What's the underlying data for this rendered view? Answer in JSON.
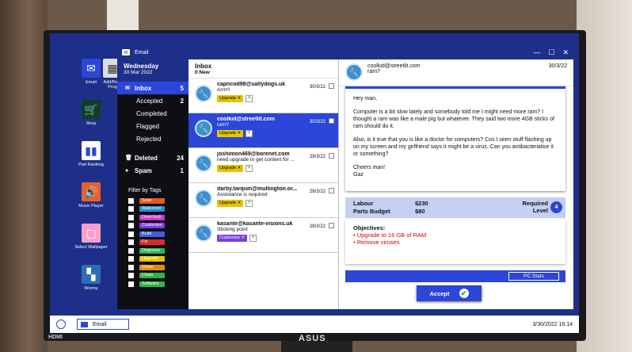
{
  "desktop": {
    "icons": [
      {
        "label": "Email",
        "name": "email",
        "color": "#2b46d8",
        "glyph": "✉"
      },
      {
        "label": "Add/Rem Prog",
        "name": "add-remove",
        "color": "#ddd",
        "glyph": "▦"
      },
      {
        "label": "Shop",
        "name": "shop",
        "color": "#1e7d3a",
        "glyph": "🛒"
      },
      {
        "label": "Part Ranking",
        "name": "part-ranking",
        "color": "#ffffff",
        "glyph": "▮"
      },
      {
        "label": "Music Player",
        "name": "music-player",
        "color": "#e8612c",
        "glyph": "🔊"
      },
      {
        "label": "Select Wallpaper",
        "name": "select-wallpaper",
        "color": "#ff9ec8",
        "glyph": "▢"
      },
      {
        "label": "Wormy",
        "name": "wormy",
        "color": "#2a6fb8",
        "glyph": "▚"
      }
    ]
  },
  "window": {
    "title": "Email"
  },
  "sidebar": {
    "day": "Wednesday",
    "date": "30 Mar 2022",
    "inbox": {
      "label": "Inbox",
      "count": "5"
    },
    "accepted": {
      "label": "Accepted",
      "count": "2"
    },
    "completed": {
      "label": "Completed"
    },
    "flagged": {
      "label": "Flagged"
    },
    "rejected": {
      "label": "Rejected"
    },
    "deleted": {
      "label": "Deleted",
      "count": "24"
    },
    "spam": {
      "label": "Spam",
      "count": "1"
    },
    "filter_title": "Filter by Tags",
    "tags": [
      {
        "label": "Scan",
        "color": "#e25a1c"
      },
      {
        "label": "Watercool",
        "color": "#2a8ad4"
      },
      {
        "label": "Overclock",
        "color": "#c43bd1"
      },
      {
        "label": "Customise",
        "color": "#7b3fe0"
      },
      {
        "label": "Build",
        "color": "#3c5ee0"
      },
      {
        "label": "Fix",
        "color": "#e02828"
      },
      {
        "label": "Diagnose",
        "color": "#2fb34a"
      },
      {
        "label": "Upgrade",
        "color": "#e5c400"
      },
      {
        "label": "Clone",
        "color": "#e08a1c"
      },
      {
        "label": "Clean",
        "color": "#2fb34a"
      },
      {
        "label": "Software",
        "color": "#2fb34a"
      }
    ]
  },
  "list": {
    "title": "Inbox",
    "subtitle": "0 New",
    "mails": [
      {
        "from": "capncod98@saltydogs.uk",
        "subject": "Arrrr!!",
        "date": "30/3/22",
        "tag": "Upgrade",
        "tag_color": "#e5c400"
      },
      {
        "from": "coolkid@streetlit.com",
        "subject": "ram?",
        "date": "30/3/22",
        "tag": "Upgrade",
        "tag_color": "#e5c400"
      },
      {
        "from": "joshimon469@borenet.com",
        "subject": "need upgrade to get content for ...",
        "date": "29/3/22",
        "tag": "Upgrade",
        "tag_color": "#e5c400"
      },
      {
        "from": "darby.tarquin@mullington.or...",
        "subject": "Assistance is required",
        "date": "28/3/22",
        "tag": "Upgrade",
        "tag_color": "#e5c400"
      },
      {
        "from": "kasante@kasante-visions.uk",
        "subject": "Sticking point",
        "date": "28/3/22",
        "tag": "Customise",
        "tag_color": "#7b3fe0"
      }
    ],
    "tag_remove": "✕",
    "add": "+"
  },
  "reader": {
    "from": "coolkid@streetlit.com",
    "subject": "ram?",
    "date": "30/3/22",
    "greeting": "Hey man,",
    "para1": "Computer is a bit slow lately and somebody told me I might need more ram? I thought a ram was like a male pig but whatever. They said two more 4GB sticks of ram should do it.",
    "para2": "Also, is it true that you is like a doctor for computers? Cos I seen stuff flashing up on my screen and my girlfriend says it might be a virus. Can you antibacterialise it or something?",
    "signoff": "Cheers man!",
    "signature": "Gaz",
    "labour_label": "Labour",
    "labour_value": "$230",
    "parts_label": "Parts Budget",
    "parts_value": "$80",
    "level_line1": "Required",
    "level_line2": "Level",
    "level": "4",
    "objectives_title": "Objectives:",
    "objectives": [
      "• Upgrade to 16 GB of RAM",
      "• Remove viruses"
    ],
    "pc_stats": "PC Stats",
    "accept": "Accept",
    "accept_icon": "✔"
  },
  "taskbar": {
    "app": "Email",
    "clock": "3/30/2022 16:14"
  },
  "monitor": {
    "brand": "ASUS",
    "input": "HDMI"
  }
}
